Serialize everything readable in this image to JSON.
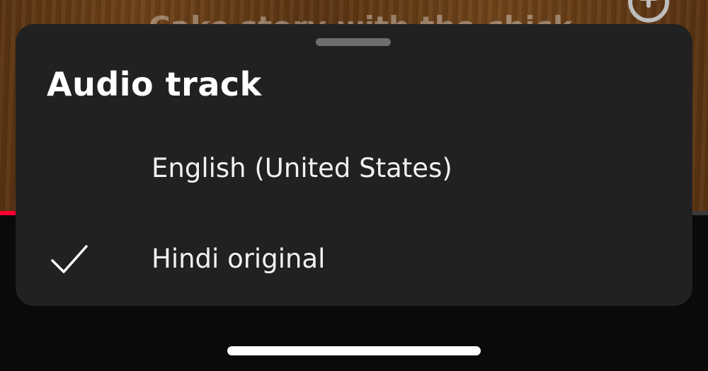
{
  "video": {
    "caption_text": "Cake story with the chick..."
  },
  "playback": {
    "progress_fraction": 0.025,
    "progress_color": "#ff0033"
  },
  "sheet": {
    "title": "Audio track",
    "options": [
      {
        "label": "English (United States)",
        "selected": false
      },
      {
        "label": "Hindi original",
        "selected": true
      }
    ],
    "selected_icon": "checkmark-icon"
  },
  "icons": {
    "top_right": "replay-icon",
    "check": "checkmark-icon"
  },
  "colors": {
    "sheet_background": "#212121",
    "text": "#ffffff",
    "accent": "#ff0033"
  }
}
